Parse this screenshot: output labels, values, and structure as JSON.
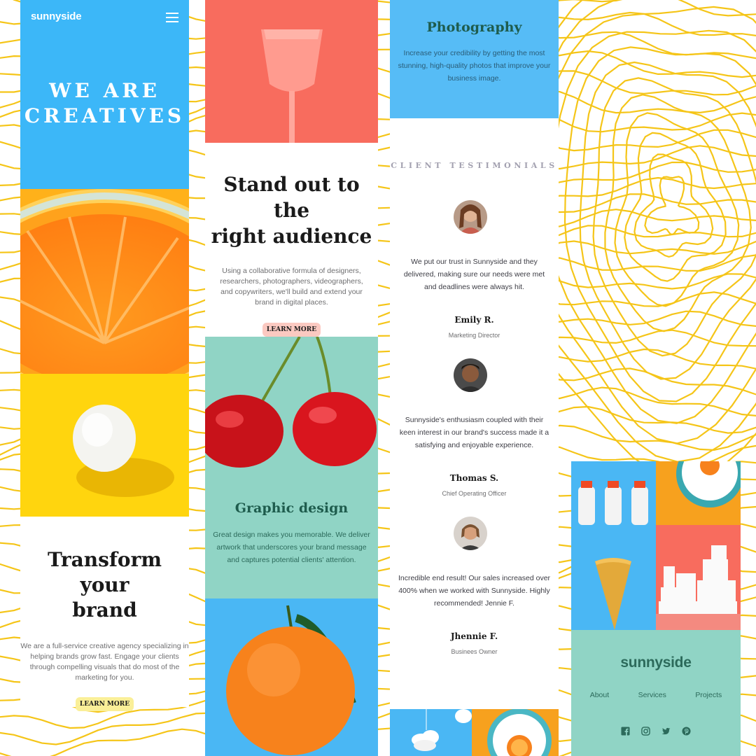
{
  "header": {
    "logo": "sunnyside",
    "menu_icon": "hamburger-menu-icon"
  },
  "hero": {
    "title_line1": "WE ARE",
    "title_line2": "CREATIVES"
  },
  "transform": {
    "title_line1": "Transform your",
    "title_line2": "brand",
    "body": "We are a full-service creative agency specializing in helping brands grow fast. Engage your clients through compelling visuals that do most of the marketing for you.",
    "button": "LEARN MORE"
  },
  "standout": {
    "title_line1": "Stand out to the",
    "title_line2": "right audience",
    "body": "Using a collaborative formula of designers, researchers, photographers, videographers, and copywriters, we'll build and extend your brand in digital places.",
    "button": "LEARN MORE"
  },
  "graphic_design": {
    "title": "Graphic design",
    "body": "Great design makes you memorable. We deliver artwork that underscores your brand message and captures potential clients' attention."
  },
  "photography": {
    "title": "Photography",
    "body": "Increase your credibility by getting the most stunning, high-quality photos that improve your business image."
  },
  "testimonials": {
    "heading": "CLIENT TESTIMONIALS",
    "items": [
      {
        "quote": "We put our trust in Sunnyside and they delivered, making sure our needs were met and deadlines were always hit.",
        "name": "Emily R.",
        "role": "Marketing Director"
      },
      {
        "quote": "Sunnyside's enthusiasm coupled with their keen interest in our brand's success made it a satisfying and enjoyable experience.",
        "name": "Thomas S.",
        "role": "Chief Operating Officer"
      },
      {
        "quote": "Incredible end result! Our sales increased over 400% when we worked with Sunnyside. Highly recommended! Jennie F.",
        "name": "Jhennie F.",
        "role": "Businees Owner"
      }
    ]
  },
  "footer": {
    "logo": "sunnyside",
    "nav": [
      "About",
      "Services",
      "Projects"
    ],
    "social": [
      "facebook-icon",
      "instagram-icon",
      "twitter-icon",
      "pinterest-icon"
    ]
  },
  "colors": {
    "hero_blue": "#3cb7f8",
    "coral": "#f86c5e",
    "mint": "#90d4c5",
    "yellow": "#ffd50e",
    "dark_green": "#1e5c4d",
    "line_yellow": "#f5c518"
  }
}
